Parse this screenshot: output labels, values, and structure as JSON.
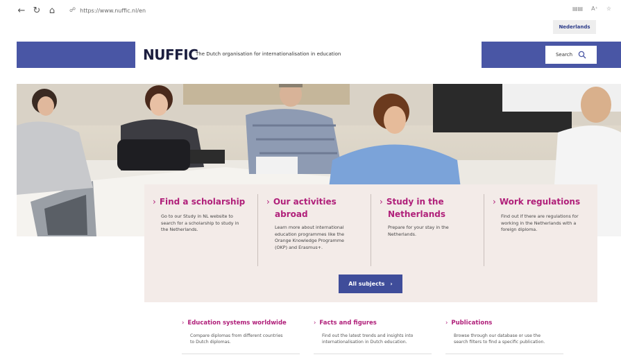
{
  "browser": {
    "url": "https://www.nuffic.nl/en"
  },
  "header": {
    "language_link": "Nederlands",
    "logo_text": "Nuffic",
    "tagline": "The Dutch organisation for internationalisation in education",
    "search_label": "Search"
  },
  "panel": {
    "columns": [
      {
        "title_line1": "Find a scholarship",
        "title_line2": "",
        "desc": [
          "Go to our Study in NL website to",
          "search for a scholarship to study in",
          "the Netherlands."
        ]
      },
      {
        "title_line1": "Our activities",
        "title_line2": "abroad",
        "desc": [
          "Learn more about international",
          "education programmes like the",
          "Orange Knowledge Programme",
          "(OKP) and Erasmus+."
        ]
      },
      {
        "title_line1": "Study in the",
        "title_line2": "Netherlands",
        "desc": [
          "Prepare for your stay in the",
          "Netherlands."
        ]
      },
      {
        "title_line1": "Work regulations",
        "title_line2": "",
        "desc": [
          "Find out if there are regulations for",
          "working in the Netherlands with a",
          "foreign diploma."
        ]
      }
    ],
    "all_subjects_label": "All subjects"
  },
  "bottom_links": [
    {
      "title": "Education systems worldwide",
      "desc": [
        "Compare diplomas from different countries",
        "to Dutch diplomas."
      ]
    },
    {
      "title": "Facts and figures",
      "desc": [
        "Find out the latest trends and insights into",
        "internationalisation in Dutch education."
      ]
    },
    {
      "title": "Publications",
      "desc": [
        "Browse through our database or use the",
        "search filters to find a specific publication."
      ]
    }
  ],
  "colors": {
    "brand_blue": "#4956a5",
    "accent_magenta": "#b0207a",
    "panel_bg": "#f3ebe8"
  },
  "icons": {
    "back": "back-arrow-icon",
    "refresh": "refresh-icon",
    "home": "home-icon",
    "lock": "lock-icon",
    "search": "search-icon",
    "chevron": "chevron-right-icon"
  }
}
